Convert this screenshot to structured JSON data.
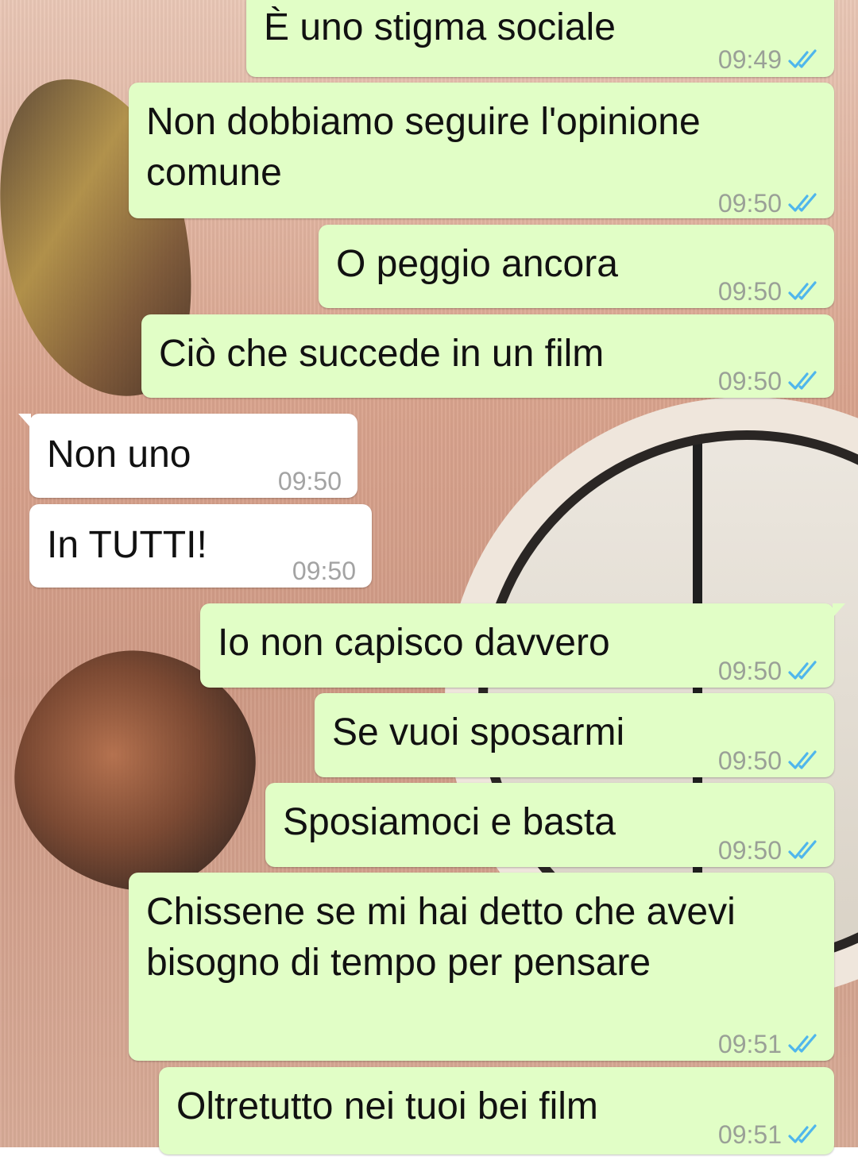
{
  "chat": {
    "messages": [
      {
        "direction": "out",
        "text": "È uno stigma sociale",
        "time": "09:49",
        "status": "read"
      },
      {
        "direction": "out",
        "text": "Non dobbiamo seguire l'opinione\ncomune",
        "time": "09:50",
        "status": "read"
      },
      {
        "direction": "out",
        "text": "O peggio ancora",
        "time": "09:50",
        "status": "read"
      },
      {
        "direction": "out",
        "text": "Ciò che succede in un film",
        "time": "09:50",
        "status": "read"
      },
      {
        "direction": "in",
        "text": "Non uno",
        "time": "09:50"
      },
      {
        "direction": "in",
        "text": "In TUTTI!",
        "time": "09:50"
      },
      {
        "direction": "out",
        "text": "Io non capisco davvero",
        "time": "09:50",
        "status": "read"
      },
      {
        "direction": "out",
        "text": "Se vuoi sposarmi",
        "time": "09:50",
        "status": "read"
      },
      {
        "direction": "out",
        "text": "Sposiamoci e basta",
        "time": "09:50",
        "status": "read"
      },
      {
        "direction": "out",
        "text": "Chissene se mi hai detto che avevi\nbisogno di tempo per pensare",
        "time": "09:51",
        "status": "read"
      },
      {
        "direction": "out",
        "text": "Oltretutto nei tuoi bei film",
        "time": "09:51",
        "status": "read"
      }
    ]
  },
  "colors": {
    "outgoing_bubble": "#e1fec6",
    "incoming_bubble": "#ffffff",
    "read_ticks": "#4fb6ec",
    "timestamp": "#9aa097"
  },
  "icons": {
    "read_status": "double-check-icon"
  }
}
